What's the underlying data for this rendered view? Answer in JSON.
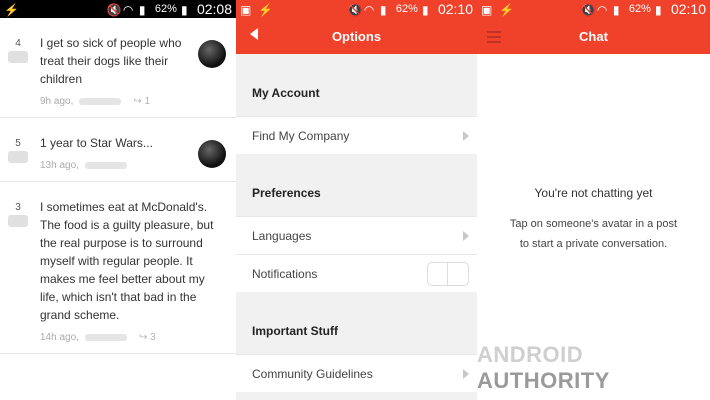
{
  "screens": {
    "feed": {
      "status": {
        "battery": "62%",
        "time": "02:08"
      },
      "posts": [
        {
          "score": "4",
          "text": "I get so sick of people who treat their dogs like their children",
          "time": "9h ago,",
          "shares": "1"
        },
        {
          "score": "5",
          "text": "1 year to Star Wars...",
          "time": "13h ago,"
        },
        {
          "score": "3",
          "text": "I sometimes eat at McDonald's. The food is a guilty pleasure, but the real purpose is to surround myself with regular people. It makes me feel better about my life, which isn't that bad in the grand scheme.",
          "time": "14h ago,",
          "shares": "3"
        }
      ]
    },
    "options": {
      "status": {
        "battery": "62%",
        "time": "02:10"
      },
      "title": "Options",
      "sections": [
        {
          "title": "My Account",
          "rows": [
            "Find My Company"
          ]
        },
        {
          "title": "Preferences",
          "rows": [
            "Languages",
            "Notifications"
          ]
        },
        {
          "title": "Important Stuff",
          "rows": [
            "Community Guidelines"
          ]
        }
      ]
    },
    "chat": {
      "status": {
        "battery": "62%",
        "time": "02:10"
      },
      "title": "Chat",
      "empty_title": "You're not chatting yet",
      "empty_text": "Tap on someone's avatar in a post to start a private conversation."
    }
  },
  "watermark": {
    "part1": "ANDROID",
    "part2": "AUTHORITY"
  },
  "colors": {
    "accent": "#f0412b",
    "statusbar_dark": "#000000"
  },
  "icons": [
    "lightning-icon",
    "image-icon",
    "mute-icon",
    "wifi-icon",
    "signal-icon",
    "battery-icon",
    "back-arrow-icon",
    "chevron-right-icon",
    "hamburger-menu-icon",
    "heart-icon",
    "share-icon"
  ]
}
